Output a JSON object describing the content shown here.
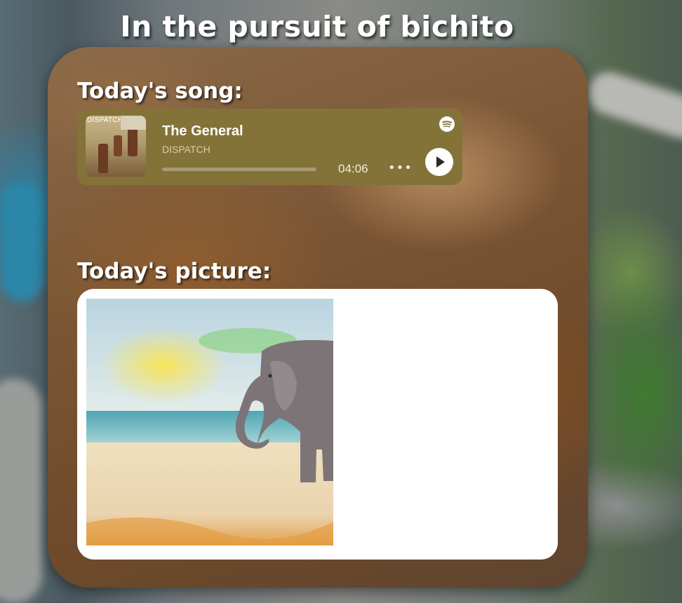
{
  "page": {
    "title": "In the pursuit of bichito"
  },
  "song_section": {
    "label": "Today's song:",
    "player": {
      "cover_text": "DISPATCH",
      "track_title": "The General",
      "artist": "DISPATCH",
      "duration": "04:06",
      "progress": 0,
      "more_label": "•••",
      "icons": {
        "spotify": "spotify-logo-icon",
        "play": "play-icon",
        "more": "more-options-icon"
      },
      "colors": {
        "background": "#847339",
        "text": "#ffffff"
      }
    }
  },
  "picture_section": {
    "label": "Today's picture:",
    "image_subject": "watercolor elephant on a beach"
  }
}
